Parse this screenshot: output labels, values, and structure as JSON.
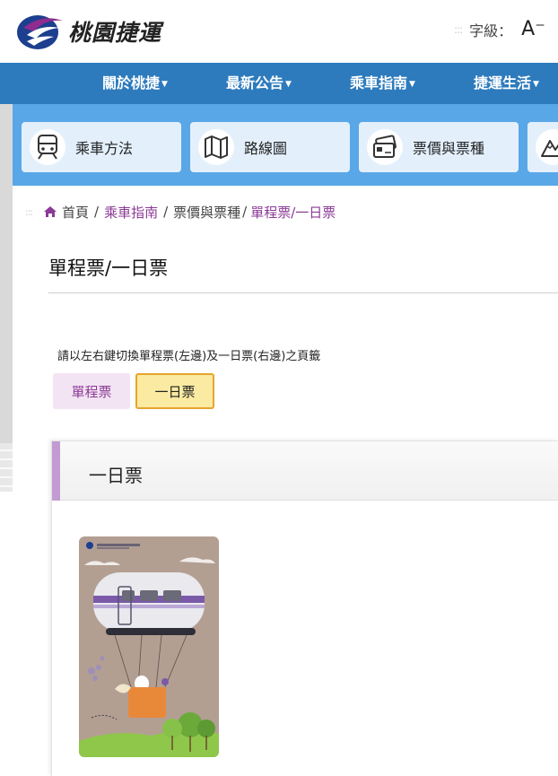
{
  "brand": {
    "name": "桃園捷運"
  },
  "font_size": {
    "label": "字級：",
    "button": "A⁻"
  },
  "nav": [
    {
      "label": "關於桃捷"
    },
    {
      "label": "最新公告"
    },
    {
      "label": "乘車指南"
    },
    {
      "label": "捷運生活"
    }
  ],
  "quick_links": [
    {
      "label": "乘車方法",
      "icon": "train-icon"
    },
    {
      "label": "路線圖",
      "icon": "map-icon"
    },
    {
      "label": "票價與票種",
      "icon": "ticket-card-icon"
    },
    {
      "label": "",
      "icon": "mountain-icon"
    }
  ],
  "breadcrumb": {
    "home": "首頁",
    "level1": "乘車指南",
    "level2": "票價與票種",
    "current": "單程票/一日票"
  },
  "page_title": "單程票/一日票",
  "hint": "請以左右鍵切換單程票(左邊)及一日票(右邊)之頁籤",
  "tabs": [
    {
      "label": "單程票",
      "active": false
    },
    {
      "label": "一日票",
      "active": true
    }
  ],
  "panel": {
    "title": "一日票"
  },
  "colors": {
    "nav": "#2d7bbd",
    "quick_bar": "#5aa7e7",
    "accent_purple": "#8b3a96",
    "active_tab": "#fbeaa1",
    "active_tab_border": "#e6a52c"
  }
}
